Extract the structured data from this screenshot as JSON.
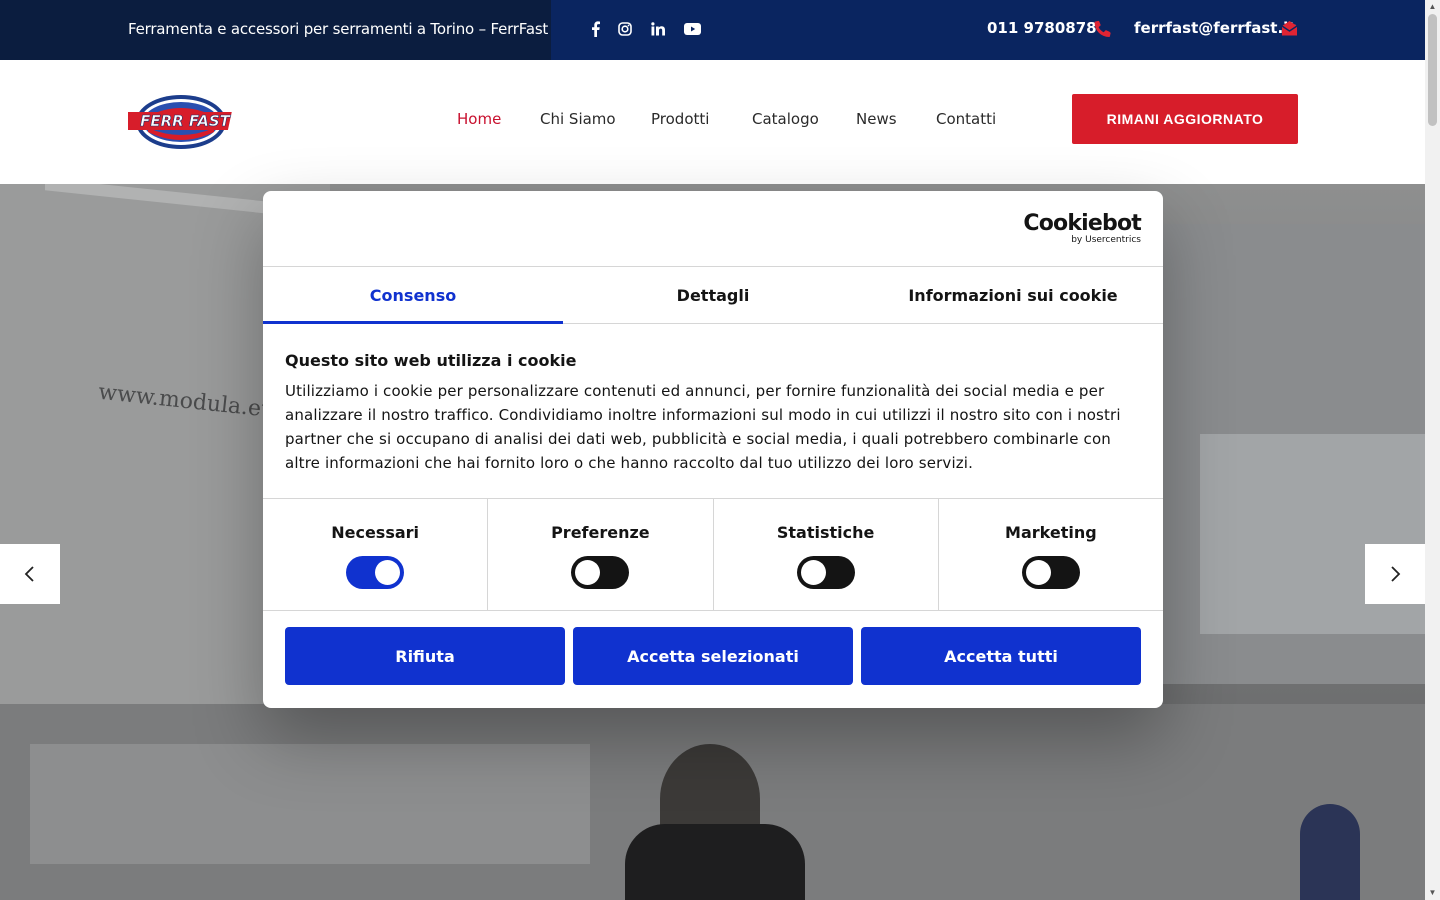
{
  "topbar": {
    "tagline": "Ferramenta e accessori per serramenti a Torino – FerrFast",
    "social": [
      {
        "name": "facebook-icon",
        "glyph": "f"
      },
      {
        "name": "instagram-icon",
        "glyph": "◎"
      },
      {
        "name": "linkedin-icon",
        "glyph": "in"
      },
      {
        "name": "youtube-icon",
        "glyph": "▶"
      }
    ],
    "phone": "011 9780878",
    "email": "ferrfast@ferrfast.it",
    "accent_color": "#e02433"
  },
  "header": {
    "logo_text": "FERR FAST",
    "nav": [
      "Home",
      "Chi Siamo",
      "Prodotti",
      "Catalogo",
      "News",
      "Contatti"
    ],
    "active_nav": "Home",
    "cta_label": "RIMANI AGGIORNATO"
  },
  "hero": {
    "banner_text": "www.modula.eu",
    "prev_label": "‹",
    "next_label": "›"
  },
  "cookie": {
    "brand": "Cookiebot",
    "brand_sub": "by Usercentrics",
    "tabs": [
      "Consenso",
      "Dettagli",
      "Informazioni sui cookie"
    ],
    "active_tab": "Consenso",
    "title": "Questo sito web utilizza i cookie",
    "body": "Utilizziamo i cookie per personalizzare contenuti ed annunci, per fornire funzionalità dei social media e per analizzare il nostro traffico. Condividiamo inoltre informazioni sul modo in cui utilizzi il nostro sito con i nostri partner che si occupano di analisi dei dati web, pubblicità e social media, i quali potrebbero combinarle con altre informazioni che hai fornito loro o che hanno raccolto dal tuo utilizzo dei loro servizi.",
    "toggles": [
      {
        "label": "Necessari",
        "on": true
      },
      {
        "label": "Preferenze",
        "on": false
      },
      {
        "label": "Statistiche",
        "on": false
      },
      {
        "label": "Marketing",
        "on": false
      }
    ],
    "buttons": {
      "reject": "Rifiuta",
      "accept_selected": "Accetta selezionati",
      "accept_all": "Accetta tutti"
    },
    "primary_color": "#1032cf"
  }
}
